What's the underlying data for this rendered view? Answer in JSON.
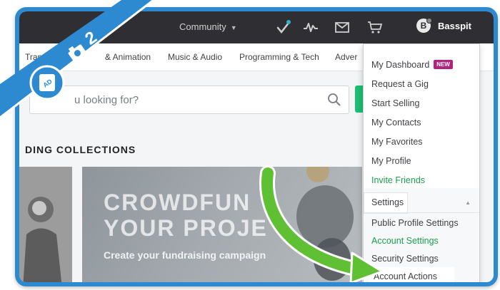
{
  "topbar": {
    "community_label": "Community",
    "username": "Basspit",
    "avatar_letter": "B"
  },
  "categories": [
    "Translation",
    "& Animation",
    "Music & Audio",
    "Programming & Tech",
    "Adver"
  ],
  "search": {
    "placeholder": "u looking for?"
  },
  "section": {
    "title": "DING COLLECTIONS"
  },
  "promo": {
    "line1": "CROWDFUN",
    "line2": "YOUR PROJE",
    "subtitle": "Create your fundraising campaign"
  },
  "dropdown": {
    "items": [
      {
        "label": "My Dashboard",
        "badge": "NEW"
      },
      {
        "label": "Request a Gig"
      },
      {
        "label": "Start Selling"
      },
      {
        "label": "My Contacts"
      },
      {
        "label": "My Favorites"
      },
      {
        "label": "My Profile"
      },
      {
        "label": "Invite Friends"
      }
    ],
    "settings_label": "Settings",
    "settings_items": [
      "Public Profile Settings",
      "Account Settings",
      "Security Settings",
      "Account Actions"
    ]
  },
  "overlay": {
    "step_number": "2"
  },
  "colors": {
    "frame": "#2d8ad0",
    "topbar": "#2f2f33",
    "green_accent": "#1a9f4c",
    "new_badge": "#b3227d",
    "arrow": "#5fc033"
  }
}
